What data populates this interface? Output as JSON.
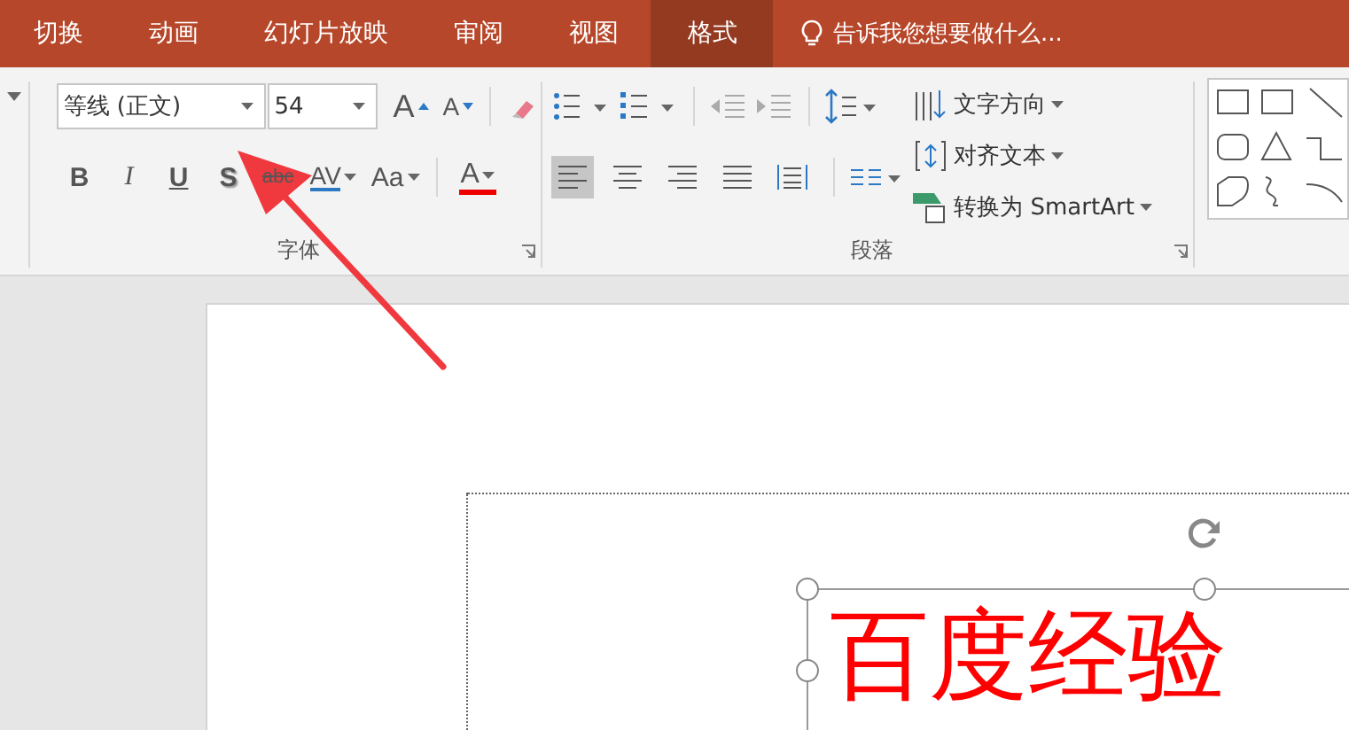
{
  "tabs": [
    {
      "label": "切换",
      "selected": false
    },
    {
      "label": "动画",
      "selected": false
    },
    {
      "label": "幻灯片放映",
      "selected": false
    },
    {
      "label": "审阅",
      "selected": false
    },
    {
      "label": "视图",
      "selected": false
    },
    {
      "label": "格式",
      "selected": true
    }
  ],
  "tell_me": {
    "placeholder": "告诉我您想要做什么..."
  },
  "font_group": {
    "label": "字体",
    "font_name": "等线 (正文)",
    "font_size": "54",
    "format_buttons": [
      {
        "label": "B",
        "kind": "bold"
      },
      {
        "label": "I",
        "kind": "italic"
      },
      {
        "label": "U",
        "kind": "underline"
      },
      {
        "label": "S",
        "kind": "shadow"
      },
      {
        "label": "abc",
        "kind": "strike"
      }
    ],
    "spacing_label": "AV",
    "case_label": "Aa",
    "color_label": "A",
    "grow_label": "A",
    "shrink_label": "A"
  },
  "paragraph_group": {
    "label": "段落",
    "alignments": [
      {
        "kind": "left",
        "selected": true
      },
      {
        "kind": "center",
        "selected": false
      },
      {
        "kind": "right",
        "selected": false
      },
      {
        "kind": "justify",
        "selected": false
      },
      {
        "kind": "distributed",
        "selected": false
      }
    ],
    "commands": [
      {
        "label": "文字方向",
        "kind": "direction"
      },
      {
        "label": "对齐文本",
        "kind": "align"
      },
      {
        "label": "转换为 SmartArt",
        "kind": "smartart"
      }
    ]
  },
  "slide": {
    "title": "百度经验"
  }
}
